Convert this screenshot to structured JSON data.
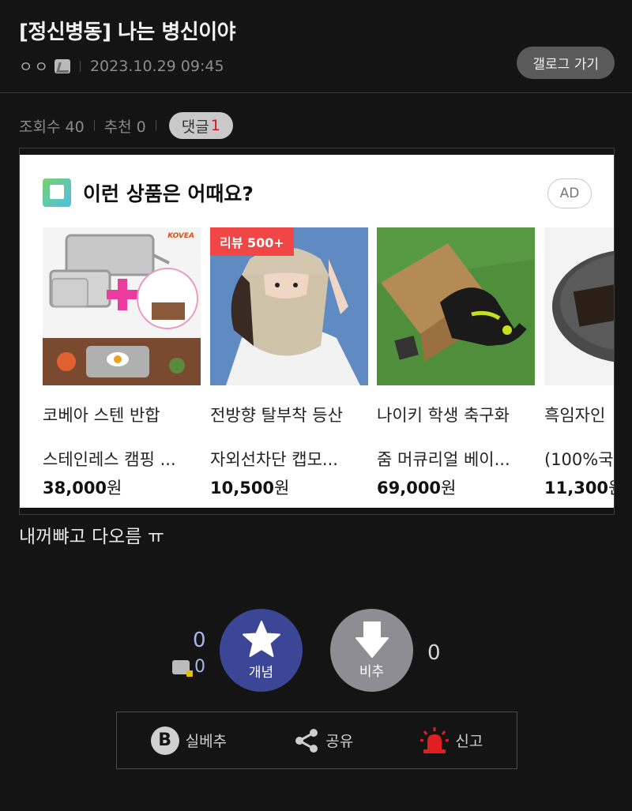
{
  "post": {
    "title": "[정신병동] 나는 병신이야",
    "author": "ㅇㅇ",
    "date": "2023.10.29 09:45",
    "gallery_button": "갤로그 가기",
    "views_label": "조회수 40",
    "recommend_label": "추천 0",
    "comment_label": "댓글",
    "comment_count": "1",
    "body": "내꺼뺘고 다오름 ㅠ"
  },
  "ad": {
    "header": "이런 상품은 어때요?",
    "badge": "AD",
    "products": [
      {
        "name1": "코베아 스텐 반합",
        "name2": "스테인레스 캠핑 ...",
        "price": "38,000",
        "won": "원",
        "brand": "KOVEA"
      },
      {
        "name1": "전방향 탈부착 등산",
        "name2": "자외선차단 캡모...",
        "price": "10,500",
        "won": "원",
        "tag": "리뷰 500+"
      },
      {
        "name1": "나이키 학생 축구화",
        "name2": "줌 머큐리얼 베이...",
        "price": "69,000",
        "won": "원"
      },
      {
        "name1": "흑임자인",
        "name2": "(100%국",
        "price": "11,300",
        "won": "원"
      }
    ]
  },
  "vote": {
    "up_count": "0",
    "fix_count": "0",
    "up_label": "개념",
    "down_label": "비추",
    "down_count": "0"
  },
  "actions": {
    "silbe": "실베추",
    "share": "공유",
    "report": "신고"
  },
  "colors": {
    "background": "#141414",
    "up_button": "#3c4697",
    "down_button": "#8e8e92",
    "report_red": "#e02020"
  }
}
